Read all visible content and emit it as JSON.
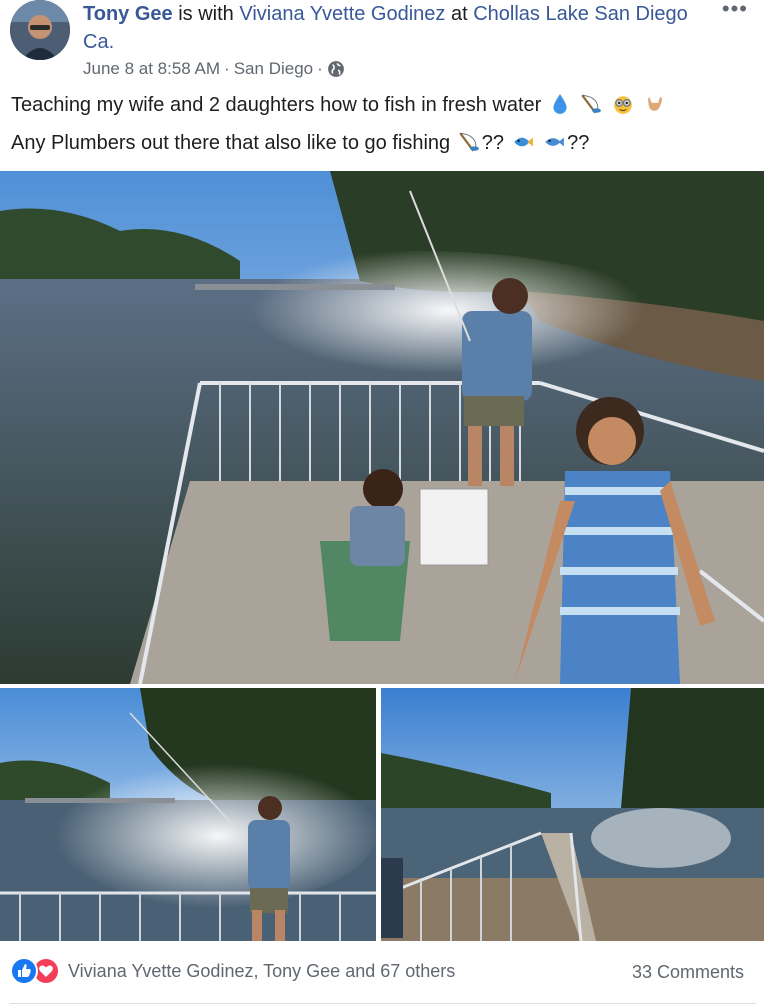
{
  "header": {
    "author": "Tony Gee",
    "with_text": " is with ",
    "tagged": "Viviana Yvette Godinez",
    "at_text": " at ",
    "location": "Chollas Lake San Diego Ca.",
    "timestamp": "June 8 at 8:58 AM",
    "separator": " · ",
    "place": "San Diego",
    "separator2": " ·",
    "more": "•••"
  },
  "post": {
    "line1": "Teaching my wife and 2 daughters how to fish in fresh water",
    "line2": "Any Plumbers out there that also like to go fishing",
    "line2_after_rod": "??",
    "line2_end": "??"
  },
  "photos": [
    {
      "name": "photo-main"
    },
    {
      "name": "photo-left"
    },
    {
      "name": "photo-right"
    }
  ],
  "footer": {
    "reactions_text": "Viviana Yvette Godinez, Tony Gee and 67 others",
    "comments": "33 Comments"
  },
  "icons": {
    "globe": "globe-icon",
    "like": "like-icon",
    "love": "love-icon",
    "more": "more-options-icon"
  },
  "colors": {
    "link": "#385898",
    "meta": "#616770",
    "like": "#1877f2",
    "love": "#f33e58"
  }
}
